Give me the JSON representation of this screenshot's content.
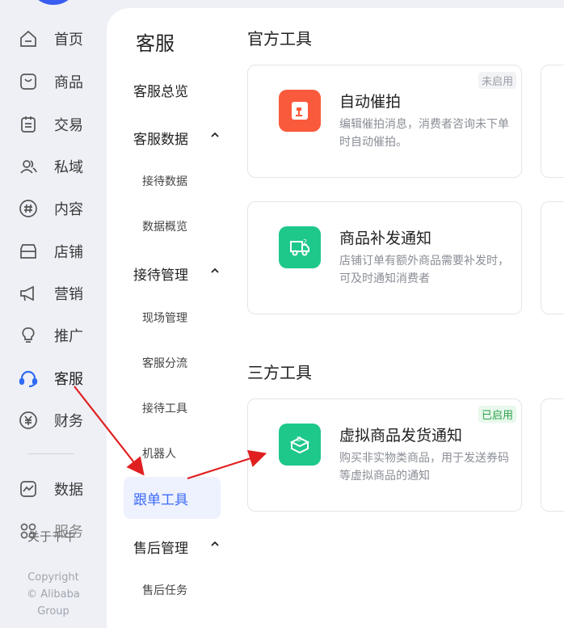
{
  "nav": {
    "items": [
      {
        "label": "首页",
        "icon": "home-icon"
      },
      {
        "label": "商品",
        "icon": "goods-icon"
      },
      {
        "label": "交易",
        "icon": "trade-icon"
      },
      {
        "label": "私域",
        "icon": "users-icon"
      },
      {
        "label": "内容",
        "icon": "hashtag-icon"
      },
      {
        "label": "店铺",
        "icon": "store-icon"
      },
      {
        "label": "营销",
        "icon": "megaphone-icon"
      },
      {
        "label": "推广",
        "icon": "lightbulb-icon"
      },
      {
        "label": "客服",
        "icon": "headset-icon",
        "active": true
      },
      {
        "label": "财务",
        "icon": "yuan-icon"
      },
      {
        "label": "数据",
        "icon": "chart-icon"
      },
      {
        "label": "服务",
        "icon": "apps-icon"
      }
    ],
    "about": "关于千牛",
    "copyright_line1": "Copyright",
    "copyright_line2": "© Alibaba",
    "copyright_line3": "Group"
  },
  "subnav": {
    "title": "客服",
    "overview": "客服总览",
    "group_data": "客服数据",
    "data_children": [
      "接待数据",
      "数据概览"
    ],
    "group_reception": "接待管理",
    "reception_children": [
      "现场管理",
      "客服分流",
      "接待工具",
      "机器人"
    ],
    "active_item": "跟单工具",
    "group_aftersale": "售后管理",
    "aftersale_children": [
      "售后任务"
    ]
  },
  "official": {
    "section_title": "官方工具",
    "cards": [
      {
        "title": "自动催拍",
        "desc": "编辑催拍消息，消费者咨询未下单时自动催拍。",
        "badge": "未启用",
        "icon": "gavel-icon",
        "color": "#fa5a3c"
      },
      {
        "title": "商品补发通知",
        "desc": "店铺订单有额外商品需要补发时，可及时通知消费者",
        "icon": "delivery-truck-icon",
        "color": "#1ec88a"
      }
    ]
  },
  "thirdparty": {
    "section_title": "三方工具",
    "cards": [
      {
        "title": "虚拟商品发货通知",
        "desc": "购买非实物类商品，用于发送券码等虚拟商品的通知",
        "badge": "已启用",
        "icon": "virtual-box-icon",
        "color": "#1ec88a"
      }
    ]
  }
}
